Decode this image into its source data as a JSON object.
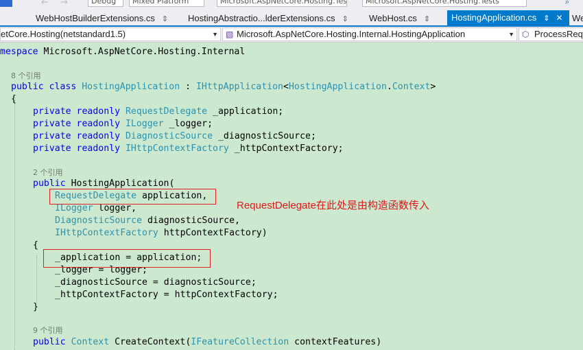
{
  "toolbar": {
    "config_value": "Debug",
    "platform_value": "Mixed Platform",
    "project_path_value": "Microsoft.AspNetCore.Hosting.Test",
    "startup_value": "Microsoft.AspNetCore.Hosting.Tests"
  },
  "tabs": [
    {
      "label": "WebHostBuilderExtensions.cs",
      "active": false
    },
    {
      "label": "HostingAbstractio...lderExtensions.cs",
      "active": false
    },
    {
      "label": "WebHost.cs",
      "active": false
    },
    {
      "label": "HostingApplication.cs",
      "active": true
    },
    {
      "label": "We"
    }
  ],
  "pin_glyph": "⇕",
  "close_glyph": "✕",
  "navbar": {
    "project_combo": "etCore.Hosting(netstandard1.5)",
    "type_combo": "Microsoft.AspNetCore.Hosting.Internal.HostingApplication",
    "member_combo": "ProcessRequ"
  },
  "code": {
    "namespace_line": {
      "kw": "mespace",
      "rest": " Microsoft.AspNetCore.Hosting.Internal"
    },
    "lens_class": "8 个引用",
    "class_decl": {
      "kw": "public class ",
      "name": "HostingApplication",
      "colon": " : ",
      "iface": "IHttpApplication",
      "lt": "<",
      "generic_type": "HostingApplication",
      "dot": ".",
      "nested": "Context",
      "gt": ">"
    },
    "open_brace": "{",
    "fields": [
      {
        "kw": "private readonly ",
        "type": "RequestDelegate",
        "name": " _application;"
      },
      {
        "kw": "private readonly ",
        "type": "ILogger",
        "name": " _logger;"
      },
      {
        "kw": "private readonly ",
        "type": "DiagnosticSource",
        "name": " _diagnosticSource;"
      },
      {
        "kw": "private readonly ",
        "type": "IHttpContextFactory",
        "name": " _httpContextFactory;"
      }
    ],
    "lens_ctor": "2 个引用",
    "ctor_decl": {
      "kw": "public",
      "rest": " HostingApplication("
    },
    "params": [
      {
        "type": "RequestDelegate",
        "name": " application,"
      },
      {
        "type": "ILogger",
        "name": " logger,"
      },
      {
        "type": "DiagnosticSource",
        "name": " diagnosticSource,"
      },
      {
        "type": "IHttpContextFactory",
        "name": " httpContextFactory)"
      }
    ],
    "ctor_open": "{",
    "body": [
      "_application = application;",
      "_logger = logger;",
      "_diagnosticSource = diagnosticSource;",
      "_httpContextFactory = httpContextFactory;"
    ],
    "ctor_close": "}",
    "lens_method": "9 个引用",
    "method_decl": {
      "kw": "public",
      "sp": " ",
      "ret": "Context",
      "name": " CreateContext(",
      "ptype": "IFeatureCollection",
      "pname": " contextFeatures)"
    }
  },
  "annotation": {
    "text": "RequestDelegate在此处是由构造函数传入",
    "color": "#e01818"
  },
  "colors": {
    "editor_bg": "#cce8cf",
    "keyword": "#0000ff",
    "type": "#2b91af",
    "active_tab": "#007acc"
  }
}
